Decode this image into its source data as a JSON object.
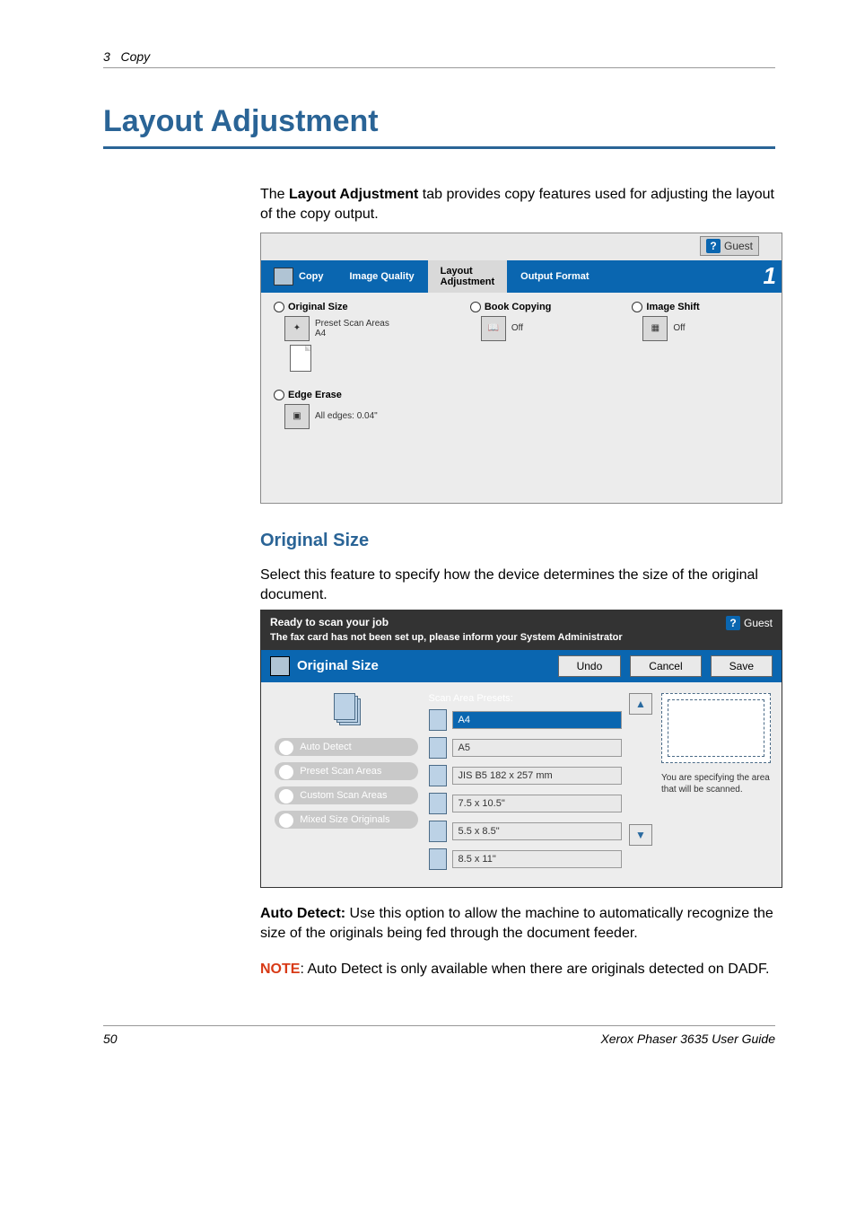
{
  "header": {
    "section_num": "3",
    "section_title": "Copy"
  },
  "h1": "Layout Adjustment",
  "intro": {
    "pre": "The ",
    "bold": "Layout Adjustment",
    "post": " tab provides copy features used for adjusting the layout of the copy output."
  },
  "panel1": {
    "guest": "Guest",
    "tabs": [
      "Copy",
      "Image Quality",
      "Layout\nAdjustment",
      "Output Format"
    ],
    "callout": "1",
    "original_size": {
      "title": "Original Size",
      "sub1": "Preset Scan Areas",
      "sub2": "A4"
    },
    "book_copying": {
      "title": "Book Copying",
      "value": "Off"
    },
    "image_shift": {
      "title": "Image Shift",
      "value": "Off"
    },
    "edge_erase": {
      "title": "Edge Erase",
      "value": "All edges: 0.04\""
    }
  },
  "h3": "Original Size",
  "p_origsize": "Select this feature to specify how the device determines the size of the original document.",
  "panel2": {
    "status": "Ready to scan your job",
    "guest": "Guest",
    "warning": "The fax card has not been set up, please inform your System Administrator",
    "bar_title": "Original Size",
    "btn_undo": "Undo",
    "btn_cancel": "Cancel",
    "btn_save": "Save",
    "pills": [
      "Auto Detect",
      "Preset Scan Areas",
      "Custom Scan Areas",
      "Mixed Size Originals"
    ],
    "mid_title": "Scan Area Presets:",
    "presets": [
      "A4",
      "A5",
      "JIS B5 182 x 257 mm",
      "7.5 x 10.5\"",
      "5.5 x 8.5\"",
      "8.5 x 11\""
    ],
    "preview_text": "You are specifying the area that will be scanned."
  },
  "autodetect": {
    "bold": "Auto Detect:",
    "text": " Use this option to allow the machine to automatically recognize the size of the originals being fed through the document feeder."
  },
  "note": {
    "label": "NOTE",
    "text": ": Auto Detect is only available when there are originals detected on DADF."
  },
  "footer": {
    "page": "50",
    "guide": "Xerox Phaser 3635 User Guide"
  }
}
